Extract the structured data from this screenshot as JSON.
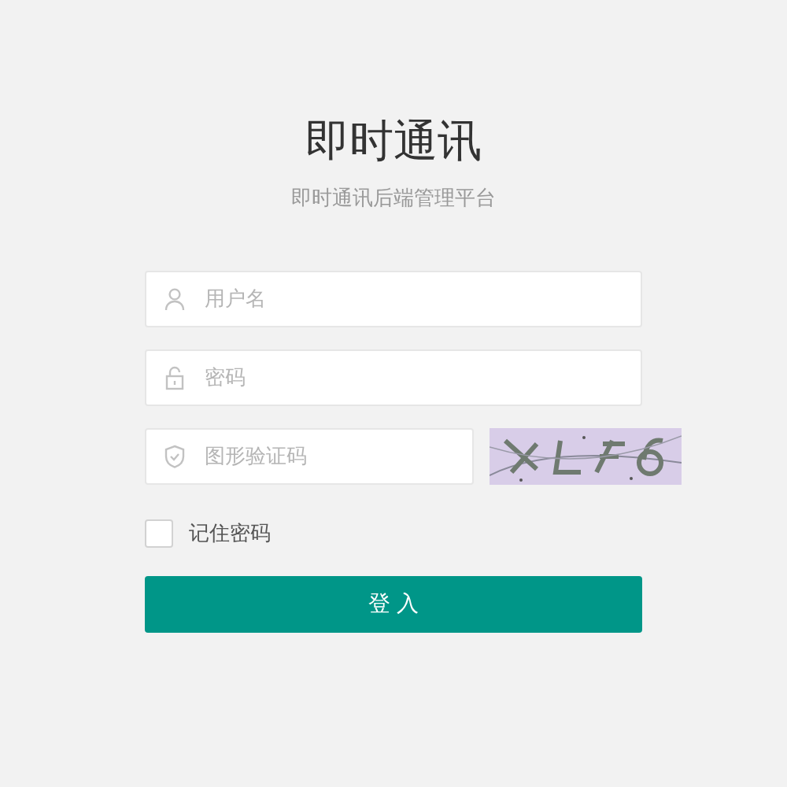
{
  "header": {
    "title": "即时通讯",
    "subtitle": "即时通讯后端管理平台"
  },
  "fields": [
    {
      "kind": "user",
      "placeholder": "用户名"
    },
    {
      "kind": "lock",
      "placeholder": "密码"
    }
  ],
  "captcha": {
    "placeholder": "图形验证码"
  },
  "remember": {
    "label": "记住密码",
    "checked": false
  },
  "submit": {
    "label": "登 入"
  }
}
